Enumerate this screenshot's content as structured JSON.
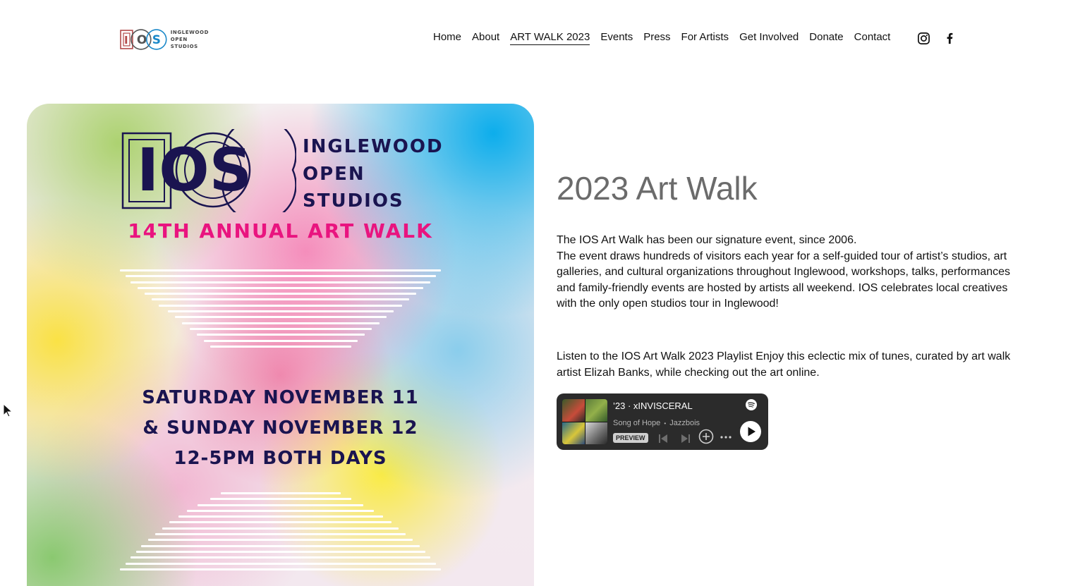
{
  "header": {
    "logo": {
      "lines": [
        "INGLEWOOD",
        "OPEN",
        "STUDIOS"
      ],
      "mark": "IOS"
    },
    "nav": [
      {
        "label": "Home",
        "name": "nav-home"
      },
      {
        "label": "About",
        "name": "nav-about"
      },
      {
        "label": "ART WALK 2023",
        "name": "nav-art-walk-2023",
        "active": true
      },
      {
        "label": "Events",
        "name": "nav-events"
      },
      {
        "label": "Press",
        "name": "nav-press"
      },
      {
        "label": "For Artists",
        "name": "nav-for-artists"
      },
      {
        "label": "Get Involved",
        "name": "nav-get-involved"
      },
      {
        "label": "Donate",
        "name": "nav-donate"
      },
      {
        "label": "Contact",
        "name": "nav-contact"
      }
    ],
    "social": [
      {
        "icon": "instagram-icon"
      },
      {
        "icon": "facebook-icon"
      }
    ]
  },
  "poster": {
    "mark": "IOS",
    "name_lines": [
      "INGLEWOOD",
      "OPEN",
      "STUDIOS"
    ],
    "subtitle": "14TH ANNUAL ART WALK",
    "dates": [
      "SATURDAY NOVEMBER 11",
      "& SUNDAY NOVEMBER 12",
      "12-5PM BOTH DAYS"
    ]
  },
  "main": {
    "title": "2023 Art Walk",
    "intro_line1": "The IOS Art Walk has been our signature event, since 2006.",
    "intro_line2": "The event draws hundreds of visitors each year for a self-guided tour of artist’s studios, art galleries, and cultural organizations throughout Inglewood, workshops, talks, performances and family-friendly events are hosted by artists all weekend. IOS celebrates local creatives with the only open studios tour in Inglewood!",
    "playlist_text": "Listen to the IOS Art Walk 2023 Playlist Enjoy this eclectic mix of tunes, curated by art walk artist Elizah Banks, while checking out the art online."
  },
  "spotify": {
    "title": "’23 · xINVISCERAL",
    "song": "Song of Hope",
    "artist": "Jazzbois",
    "separator": "•",
    "preview_label": "PREVIEW",
    "icons": [
      "spotify-icon",
      "previous-track-icon",
      "next-track-icon",
      "add-icon",
      "more-icon",
      "play-icon"
    ]
  },
  "colors": {
    "navy": "#1a1450",
    "magenta": "#e9147f",
    "title_gray": "#6b6b6b",
    "spotify_bg": "#2b2b2b"
  }
}
